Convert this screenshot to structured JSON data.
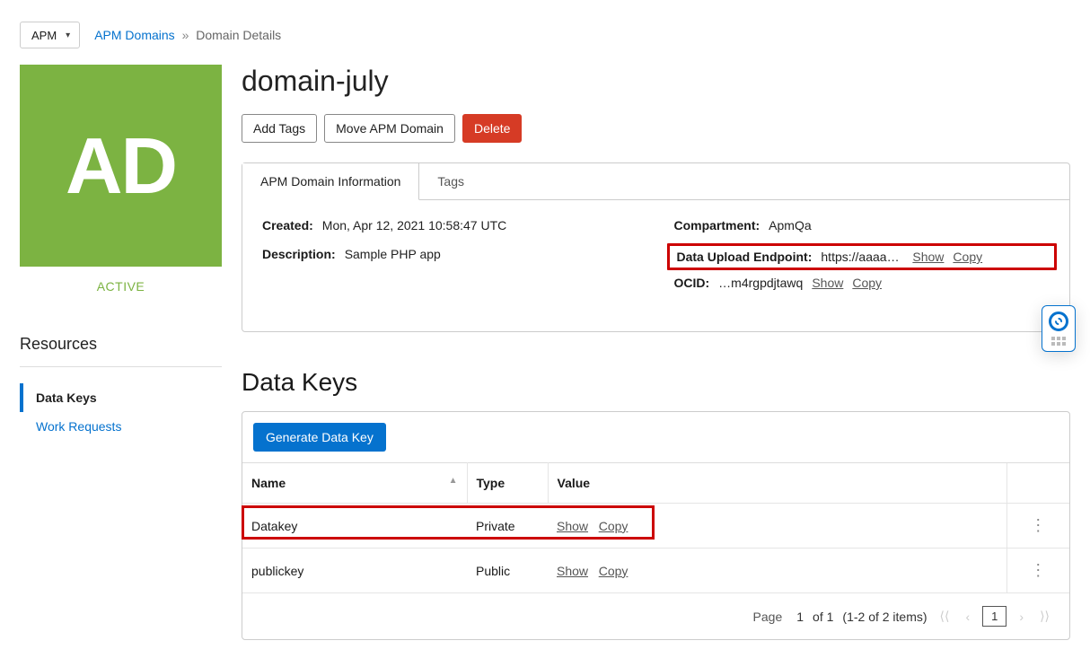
{
  "selector": {
    "label": "APM"
  },
  "breadcrumb": {
    "root": "APM Domains",
    "current": "Domain Details"
  },
  "avatar": {
    "initials": "AD",
    "status": "ACTIVE"
  },
  "resources": {
    "title": "Resources",
    "items": [
      "Data Keys",
      "Work Requests"
    ],
    "activeIndex": 0
  },
  "header": {
    "title": "domain-july",
    "buttons": {
      "addTags": "Add Tags",
      "move": "Move APM Domain",
      "delete": "Delete"
    }
  },
  "tabs": {
    "info": "APM Domain Information",
    "tags": "Tags"
  },
  "info": {
    "created_label": "Created:",
    "created_value": "Mon, Apr 12, 2021 10:58:47 UTC",
    "desc_label": "Description:",
    "desc_value": "Sample PHP app",
    "comp_label": "Compartment:",
    "comp_value": "ApmQa",
    "upload_label": "Data Upload Endpoint:",
    "upload_value": "https://aaaac…",
    "ocid_label": "OCID:",
    "ocid_value": "…m4rgpdjtawq",
    "show": "Show",
    "copy": "Copy"
  },
  "dataKeys": {
    "title": "Data Keys",
    "generate": "Generate Data Key",
    "cols": {
      "name": "Name",
      "type": "Type",
      "value": "Value"
    },
    "rows": [
      {
        "name": "Datakey",
        "type": "Private"
      },
      {
        "name": "publickey",
        "type": "Public"
      }
    ],
    "show": "Show",
    "copy": "Copy"
  },
  "pager": {
    "page_label": "Page",
    "page_num": "1",
    "of_text": "of 1",
    "range": "(1-2 of 2 items)"
  }
}
